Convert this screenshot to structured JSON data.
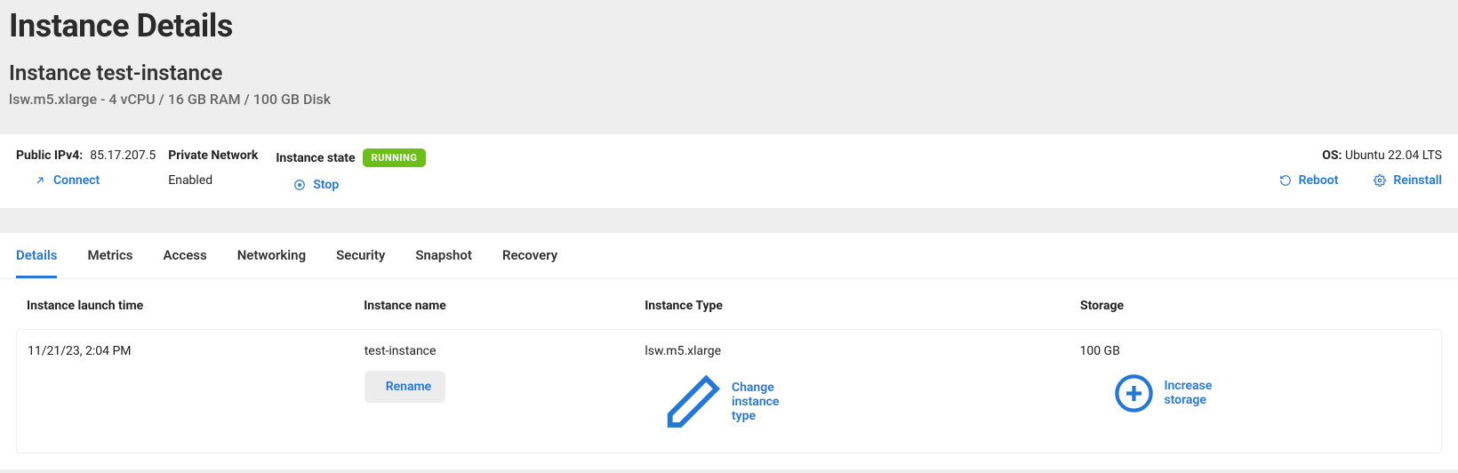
{
  "header": {
    "page_title": "Instance Details",
    "instance_title": "Instance test-instance",
    "spec_line": "lsw.m5.xlarge - 4 vCPU / 16 GB RAM / 100 GB Disk"
  },
  "info": {
    "public_ip_label": "Public IPv4:",
    "public_ip_value": "85.17.207.5",
    "connect_label": "Connect",
    "private_network_label": "Private Network",
    "private_network_value": "Enabled",
    "instance_state_label": "Instance state",
    "state_badge": "RUNNING",
    "stop_label": "Stop",
    "os_label": "OS:",
    "os_value": "Ubuntu 22.04 LTS",
    "reboot_label": "Reboot",
    "reinstall_label": "Reinstall"
  },
  "tabs": [
    {
      "label": "Details",
      "active": true
    },
    {
      "label": "Metrics",
      "active": false
    },
    {
      "label": "Access",
      "active": false
    },
    {
      "label": "Networking",
      "active": false
    },
    {
      "label": "Security",
      "active": false
    },
    {
      "label": "Snapshot",
      "active": false
    },
    {
      "label": "Recovery",
      "active": false
    }
  ],
  "details": {
    "columns": {
      "launch": "Instance launch time",
      "name": "Instance name",
      "type": "Instance Type",
      "storage": "Storage"
    },
    "row": {
      "launch": "11/21/23, 2:04 PM",
      "name": "test-instance",
      "type": "lsw.m5.xlarge",
      "storage": "100 GB"
    },
    "actions": {
      "rename": "Rename",
      "change_type": "Change instance type",
      "increase_storage": "Increase storage"
    }
  }
}
